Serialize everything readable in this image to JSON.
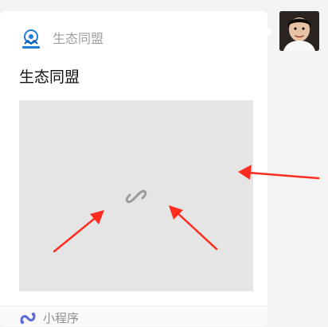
{
  "card": {
    "app_name": "生态同盟",
    "title": "生态同盟",
    "footer_label": "小程序",
    "logo_icon": "brand-logo-icon",
    "link_icon": "link-icon",
    "miniprogram_icon": "miniprogram-icon"
  },
  "avatar": {
    "icon": "user-avatar"
  },
  "annotations": {
    "arrow_color": "#ff2c1f",
    "arrows": [
      "arrow-left",
      "arrow-center",
      "arrow-right"
    ]
  },
  "colors": {
    "background": "#f3f3f3",
    "card": "#ffffff",
    "preview": "#e5e5e5",
    "accent": "#5b6cd6"
  }
}
